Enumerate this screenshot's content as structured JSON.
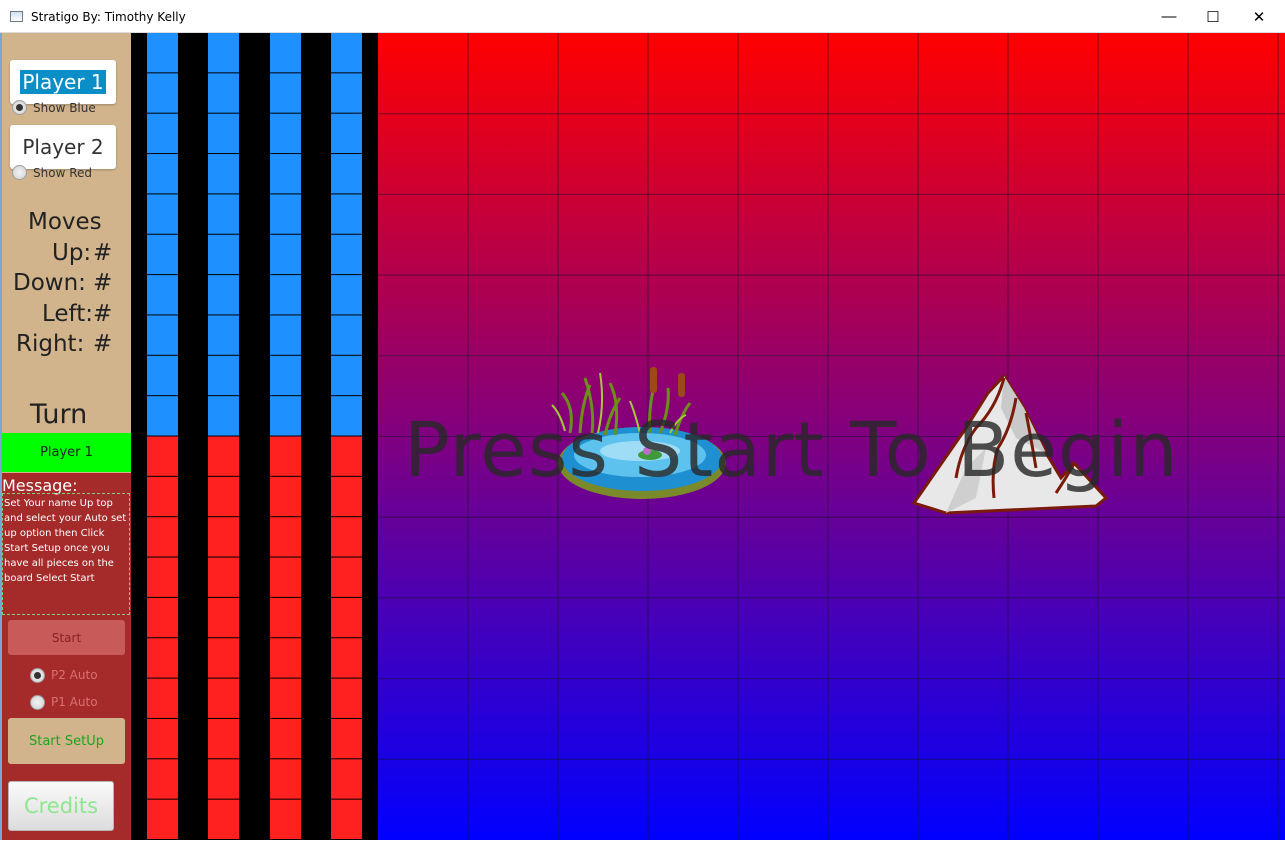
{
  "window": {
    "title": "Stratigo By: Timothy Kelly",
    "controls": {
      "minimize": "—",
      "maximize": "☐",
      "close": "✕"
    }
  },
  "sidebar": {
    "player1": {
      "name": "Player 1",
      "radio_label": "Show Blue",
      "radio_selected": true
    },
    "player2": {
      "name": "Player 2",
      "radio_label": "Show Red",
      "radio_selected": false
    },
    "moves": {
      "heading": "Moves",
      "up_label": "Up:",
      "up_value": "#",
      "down_label": "Down:",
      "down_value": "#",
      "left_label": "Left:",
      "left_value": "#",
      "right_label": "Right:",
      "right_value": "#"
    },
    "turn": {
      "heading": "Turn",
      "current": "Player 1"
    },
    "message": {
      "label": "Message:",
      "text": "Set Your name Up top and select your Auto set up option then Click Start Setup once you have all pieces on the board Select Start"
    },
    "start_button": "Start",
    "auto_options": [
      {
        "label": "P2 Auto",
        "selected": true
      },
      {
        "label": "P1 Auto",
        "selected": false
      }
    ],
    "setup_button": "Start SetUp",
    "credits_button": "Credits"
  },
  "tray": {
    "columns": 4,
    "blue_rows": 10,
    "red_rows": 10,
    "blue_color": "#1e90ff",
    "red_color": "#ff2020"
  },
  "board": {
    "columns": 10,
    "rows": 10,
    "gradient_top": "#ff0000",
    "gradient_bottom": "#0000ff",
    "overlay_text": "Press Start To Begin",
    "obstacles": [
      "pond-icon",
      "mountain-icon"
    ]
  },
  "colors": {
    "sidebar_tan": "#d2b48c",
    "sidebar_brown": "#a52a2a",
    "turn_green": "#00ff00",
    "selection_blue": "#0a8ec7"
  }
}
